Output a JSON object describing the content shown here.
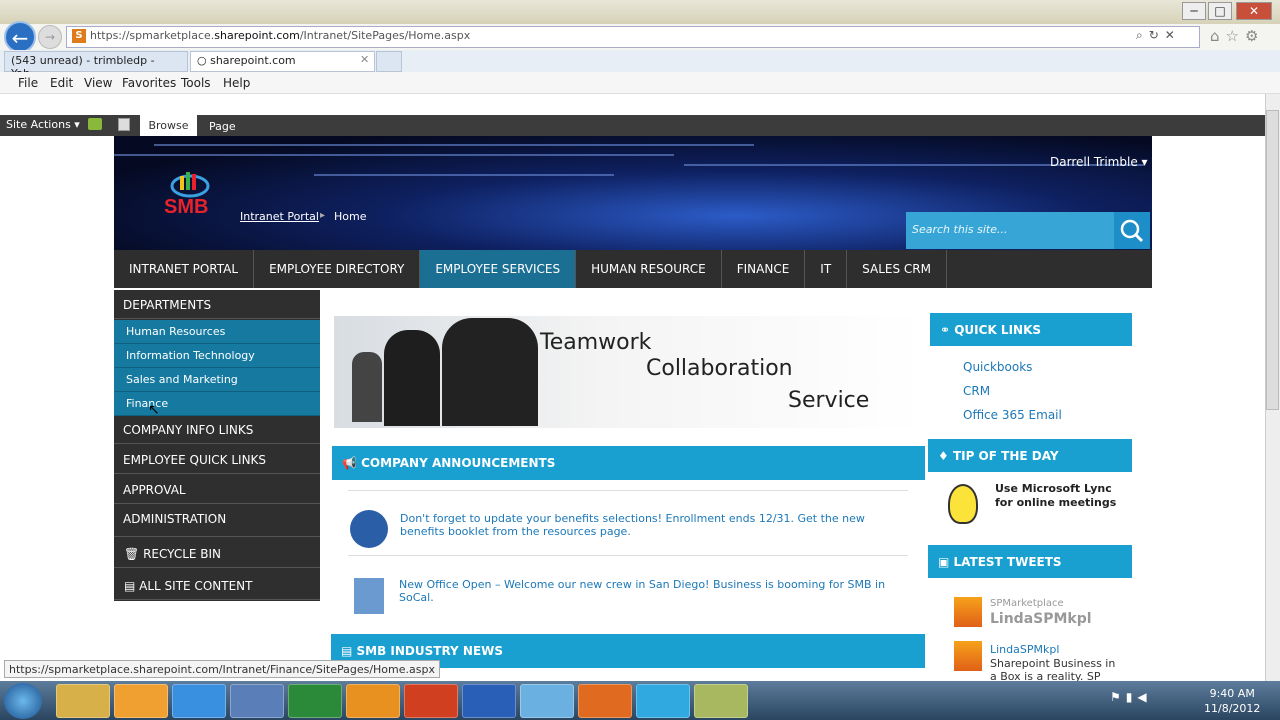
{
  "browser": {
    "url_prefix": "https://spmarketplace.",
    "url_domain": "sharepoint.com",
    "url_path": "/Intranet/SitePages/Home.aspx",
    "favicon": "S",
    "tabs": [
      {
        "label": "(543 unread) - trimbledp - Yah..."
      },
      {
        "label": "sharepoint.com"
      }
    ],
    "tab_close": "✕",
    "menu": [
      "File",
      "Edit",
      "View",
      "Favorites",
      "Tools",
      "Help"
    ],
    "win_min": "─",
    "win_max": "□",
    "win_close": "✕"
  },
  "ribbon": {
    "site_actions": "Site Actions ▾",
    "browse": "Browse",
    "page": "Page"
  },
  "site": {
    "logo": "SMB",
    "breadcrumb": [
      "Intranet Portal",
      "Home"
    ],
    "user": "Darrell Trimble ▾",
    "search_placeholder": "Search this site...",
    "topnav": [
      "INTRANET PORTAL",
      "EMPLOYEE DIRECTORY",
      "EMPLOYEE SERVICES",
      "HUMAN RESOURCE",
      "FINANCE",
      "IT",
      "SALES CRM"
    ],
    "leftnav": {
      "departments": "DEPARTMENTS",
      "dept_items": [
        "Human Resources",
        "Information Technology",
        "Sales and Marketing",
        "Finance"
      ],
      "company_info": "COMPANY INFO LINKS",
      "employee_quick": "EMPLOYEE QUICK LINKS",
      "approval": "APPROVAL",
      "administration": "ADMINISTRATION",
      "recycle_bin": "RECYCLE BIN",
      "all_site_content": "ALL SITE CONTENT"
    },
    "hero": {
      "line1": "Teamwork",
      "line2": "Collaboration",
      "line3": "Service"
    },
    "announcements": {
      "title": "COMPANY ANNOUNCEMENTS",
      "items": [
        "Don't forget to update your benefits selections! Enrollment ends 12/31. Get the new benefits booklet from the resources page.",
        "New Office Open – Welcome our new crew in San Diego! Business is booming for SMB in SoCal."
      ]
    },
    "industry_news": "SMB INDUSTRY NEWS",
    "quick_links": {
      "title": "QUICK LINKS",
      "items": [
        "Quickbooks",
        "CRM",
        "Office 365 Email"
      ]
    },
    "tip": {
      "title": "TIP OF THE DAY",
      "line1": "Use Microsoft Lync",
      "line2": "for online meetings"
    },
    "tweets": {
      "title": "LATEST TWEETS",
      "items": [
        {
          "handle": "SPMarketplace",
          "name": "LindaSPMkpl"
        },
        {
          "handle": "LindaSPMkpl",
          "text": "Sharepoint Business in a Box is a reality. SP"
        }
      ]
    }
  },
  "status_url": "https://spmarketplace.sharepoint.com/Intranet/Finance/SitePages/Home.aspx",
  "taskbar": {
    "time": "9:40 AM",
    "date": "11/8/2012"
  }
}
